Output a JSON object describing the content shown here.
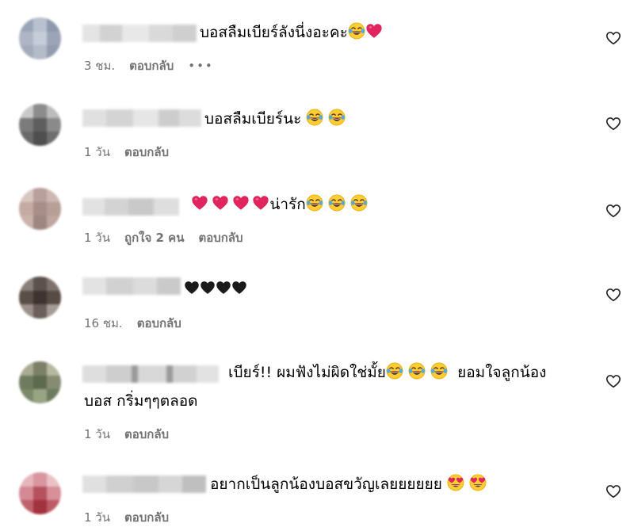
{
  "comments": [
    {
      "text": "บอสลืมเบียร์ลังนี่งอะคะ",
      "emojis": [
        "laugh-cry-emoji",
        "red-heart-emoji"
      ],
      "time": "3 ชม.",
      "reply_label": "ตอบกลับ",
      "more_label": "•••"
    },
    {
      "text": "บอสลืมเบียร์นะ",
      "emojis": [
        "laugh-cry-emoji",
        "laugh-cry-emoji"
      ],
      "time": "1 วัน",
      "reply_label": "ตอบกลับ"
    },
    {
      "text": "น่ารัก",
      "emojis_before": [
        "red-heart-emoji",
        "red-heart-emoji",
        "red-heart-emoji",
        "red-heart-emoji"
      ],
      "emojis": [
        "laugh-cry-emoji",
        "laugh-cry-emoji",
        "laugh-cry-emoji"
      ],
      "time": "1 วัน",
      "likes": "ถูกใจ 2 คน",
      "reply_label": "ตอบกลับ"
    },
    {
      "text": "",
      "emojis": [
        "black-heart-emoji",
        "black-heart-emoji",
        "black-heart-emoji",
        "black-heart-emoji"
      ],
      "time": "16 ชม.",
      "reply_label": "ตอบกลับ"
    },
    {
      "text_part1": "เบียร์!! ผมฟังไม่ผิดใช่มั้ย",
      "text_part2": "ยอมใจลูกน้อง",
      "text_line2": "บอส กริ่มๆๆตลอด",
      "emojis": [
        "laugh-cry-emoji",
        "laugh-cry-emoji",
        "laugh-cry-emoji"
      ],
      "time": "1 วัน",
      "reply_label": "ตอบกลับ"
    },
    {
      "text": "อยากเป็นลูกน้องบอสขวัญเลยยยยยย",
      "emojis": [
        "heart-eyes-emoji",
        "heart-eyes-emoji"
      ],
      "time": "1 วัน",
      "reply_label": "ตอบกลับ"
    }
  ],
  "colors": {
    "meta_text": "#737373",
    "red_heart": "#e0245e",
    "emoji_yellow": "#ffcc33"
  }
}
